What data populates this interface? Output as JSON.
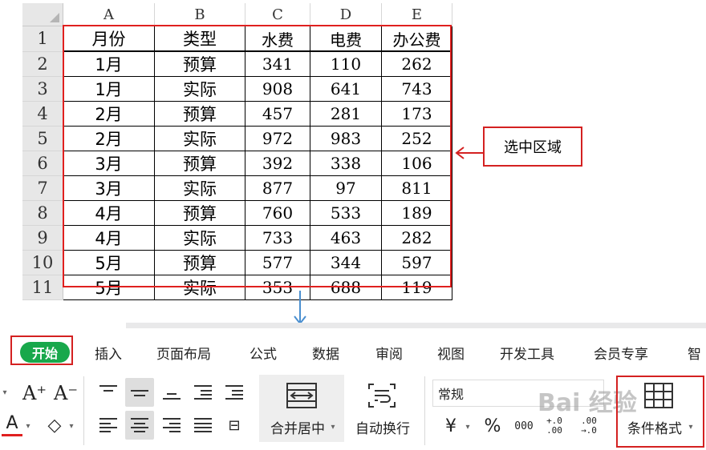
{
  "sheet": {
    "columns": [
      "A",
      "B",
      "C",
      "D",
      "E"
    ],
    "row_numbers": [
      "1",
      "2",
      "3",
      "4",
      "5",
      "6",
      "7",
      "8",
      "9",
      "10",
      "11"
    ],
    "header": [
      "月份",
      "类型",
      "水费",
      "电费",
      "办公费"
    ],
    "rows": [
      [
        "1月",
        "预算",
        "341",
        "110",
        "262"
      ],
      [
        "1月",
        "实际",
        "908",
        "641",
        "743"
      ],
      [
        "2月",
        "预算",
        "457",
        "281",
        "173"
      ],
      [
        "2月",
        "实际",
        "972",
        "983",
        "252"
      ],
      [
        "3月",
        "预算",
        "392",
        "338",
        "106"
      ],
      [
        "3月",
        "实际",
        "877",
        "97",
        "811"
      ],
      [
        "4月",
        "预算",
        "760",
        "533",
        "189"
      ],
      [
        "4月",
        "实际",
        "733",
        "463",
        "282"
      ],
      [
        "5月",
        "预算",
        "577",
        "344",
        "597"
      ],
      [
        "5月",
        "实际",
        "353",
        "688",
        "119"
      ]
    ]
  },
  "callout": {
    "label": "选中区域"
  },
  "ribbon": {
    "tabs": [
      "开始",
      "插入",
      "页面布局",
      "公式",
      "数据",
      "审阅",
      "视图",
      "开发工具",
      "会员专享",
      "智"
    ],
    "font_grow": "A⁺",
    "font_shrink": "A⁻",
    "font_color": "A",
    "merge_label": "合并居中",
    "wrap_label": "自动换行",
    "number_format": "常规",
    "currency": "¥",
    "percent": "%",
    "thousands": "000",
    "dec_inc": "+.0 .00",
    "dec_dec": ".00 →.0",
    "cond_format_label": "条件格式",
    "watermark": "Bai 经验"
  },
  "colors": {
    "selection": "#e0201f",
    "accent_green": "#18a84b",
    "arrow_blue": "#4a8fd0"
  }
}
